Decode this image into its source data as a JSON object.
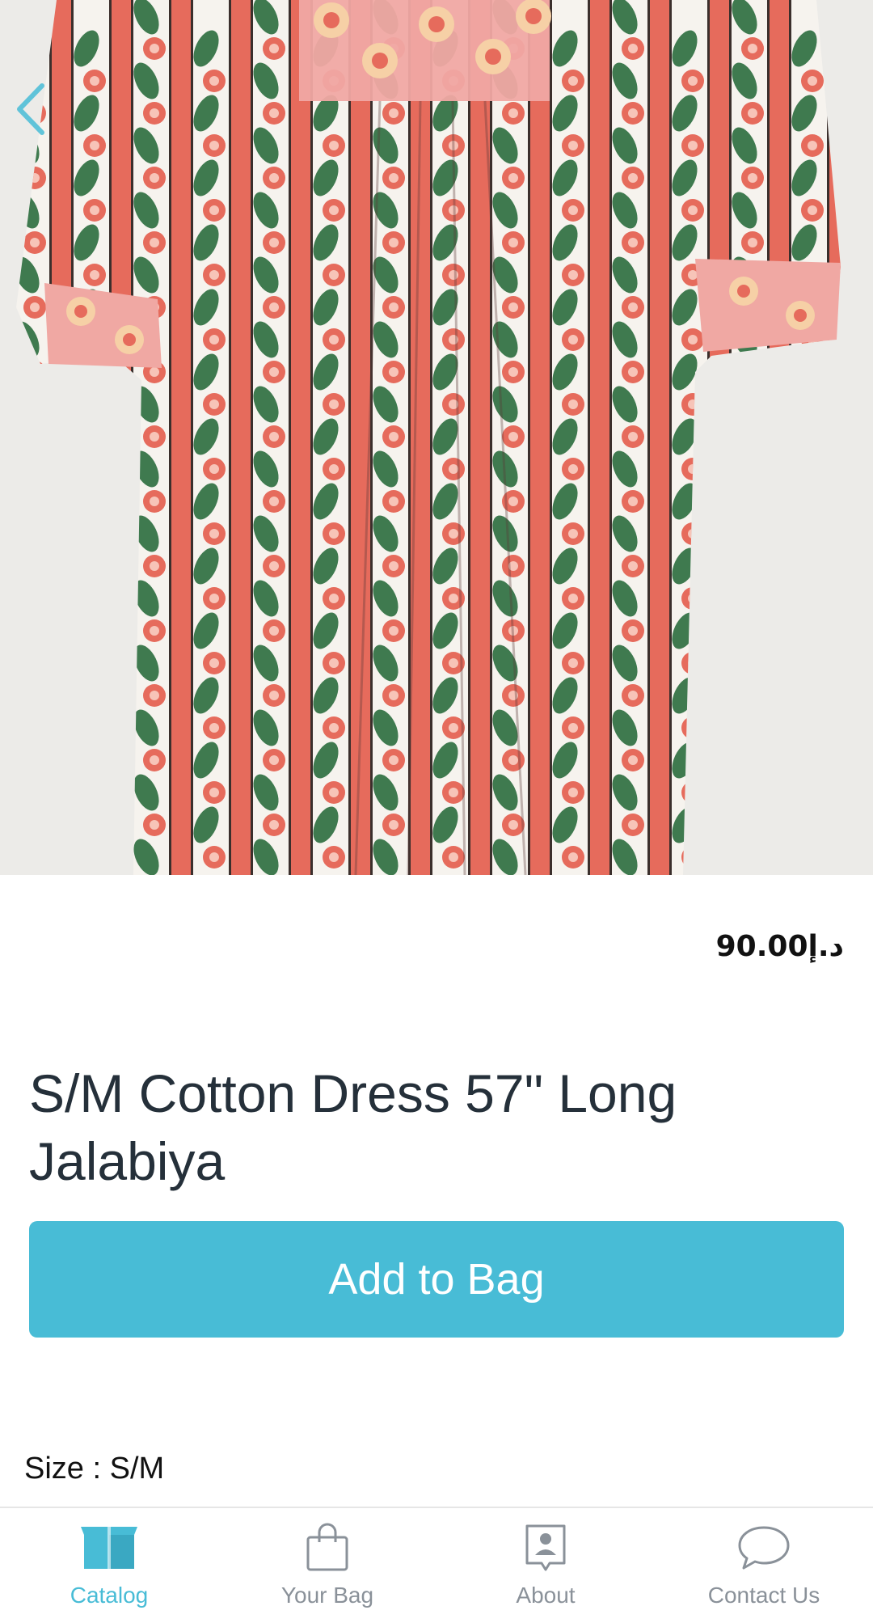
{
  "product": {
    "price": "90.00د.إ",
    "title": "S/M Cotton Dress 57\" Long Jalabiya",
    "add_to_bag_label": "Add to Bag",
    "size_line": "Size : S/M"
  },
  "navigation": {
    "back_icon": "chevron-left-icon",
    "items": [
      {
        "label": "Catalog",
        "icon": "box-icon",
        "active": true
      },
      {
        "label": "Your Bag",
        "icon": "shopping-bag-icon",
        "active": false
      },
      {
        "label": "About",
        "icon": "contact-card-icon",
        "active": false
      },
      {
        "label": "Contact Us",
        "icon": "chat-bubble-icon",
        "active": false
      }
    ]
  },
  "colors": {
    "accent": "#48bcd6",
    "title_text": "#25303a",
    "nav_inactive": "#8a9199",
    "dress_coral": "#e66b5c",
    "dress_green": "#3f7a4f",
    "dress_pink": "#f0a8a3"
  }
}
